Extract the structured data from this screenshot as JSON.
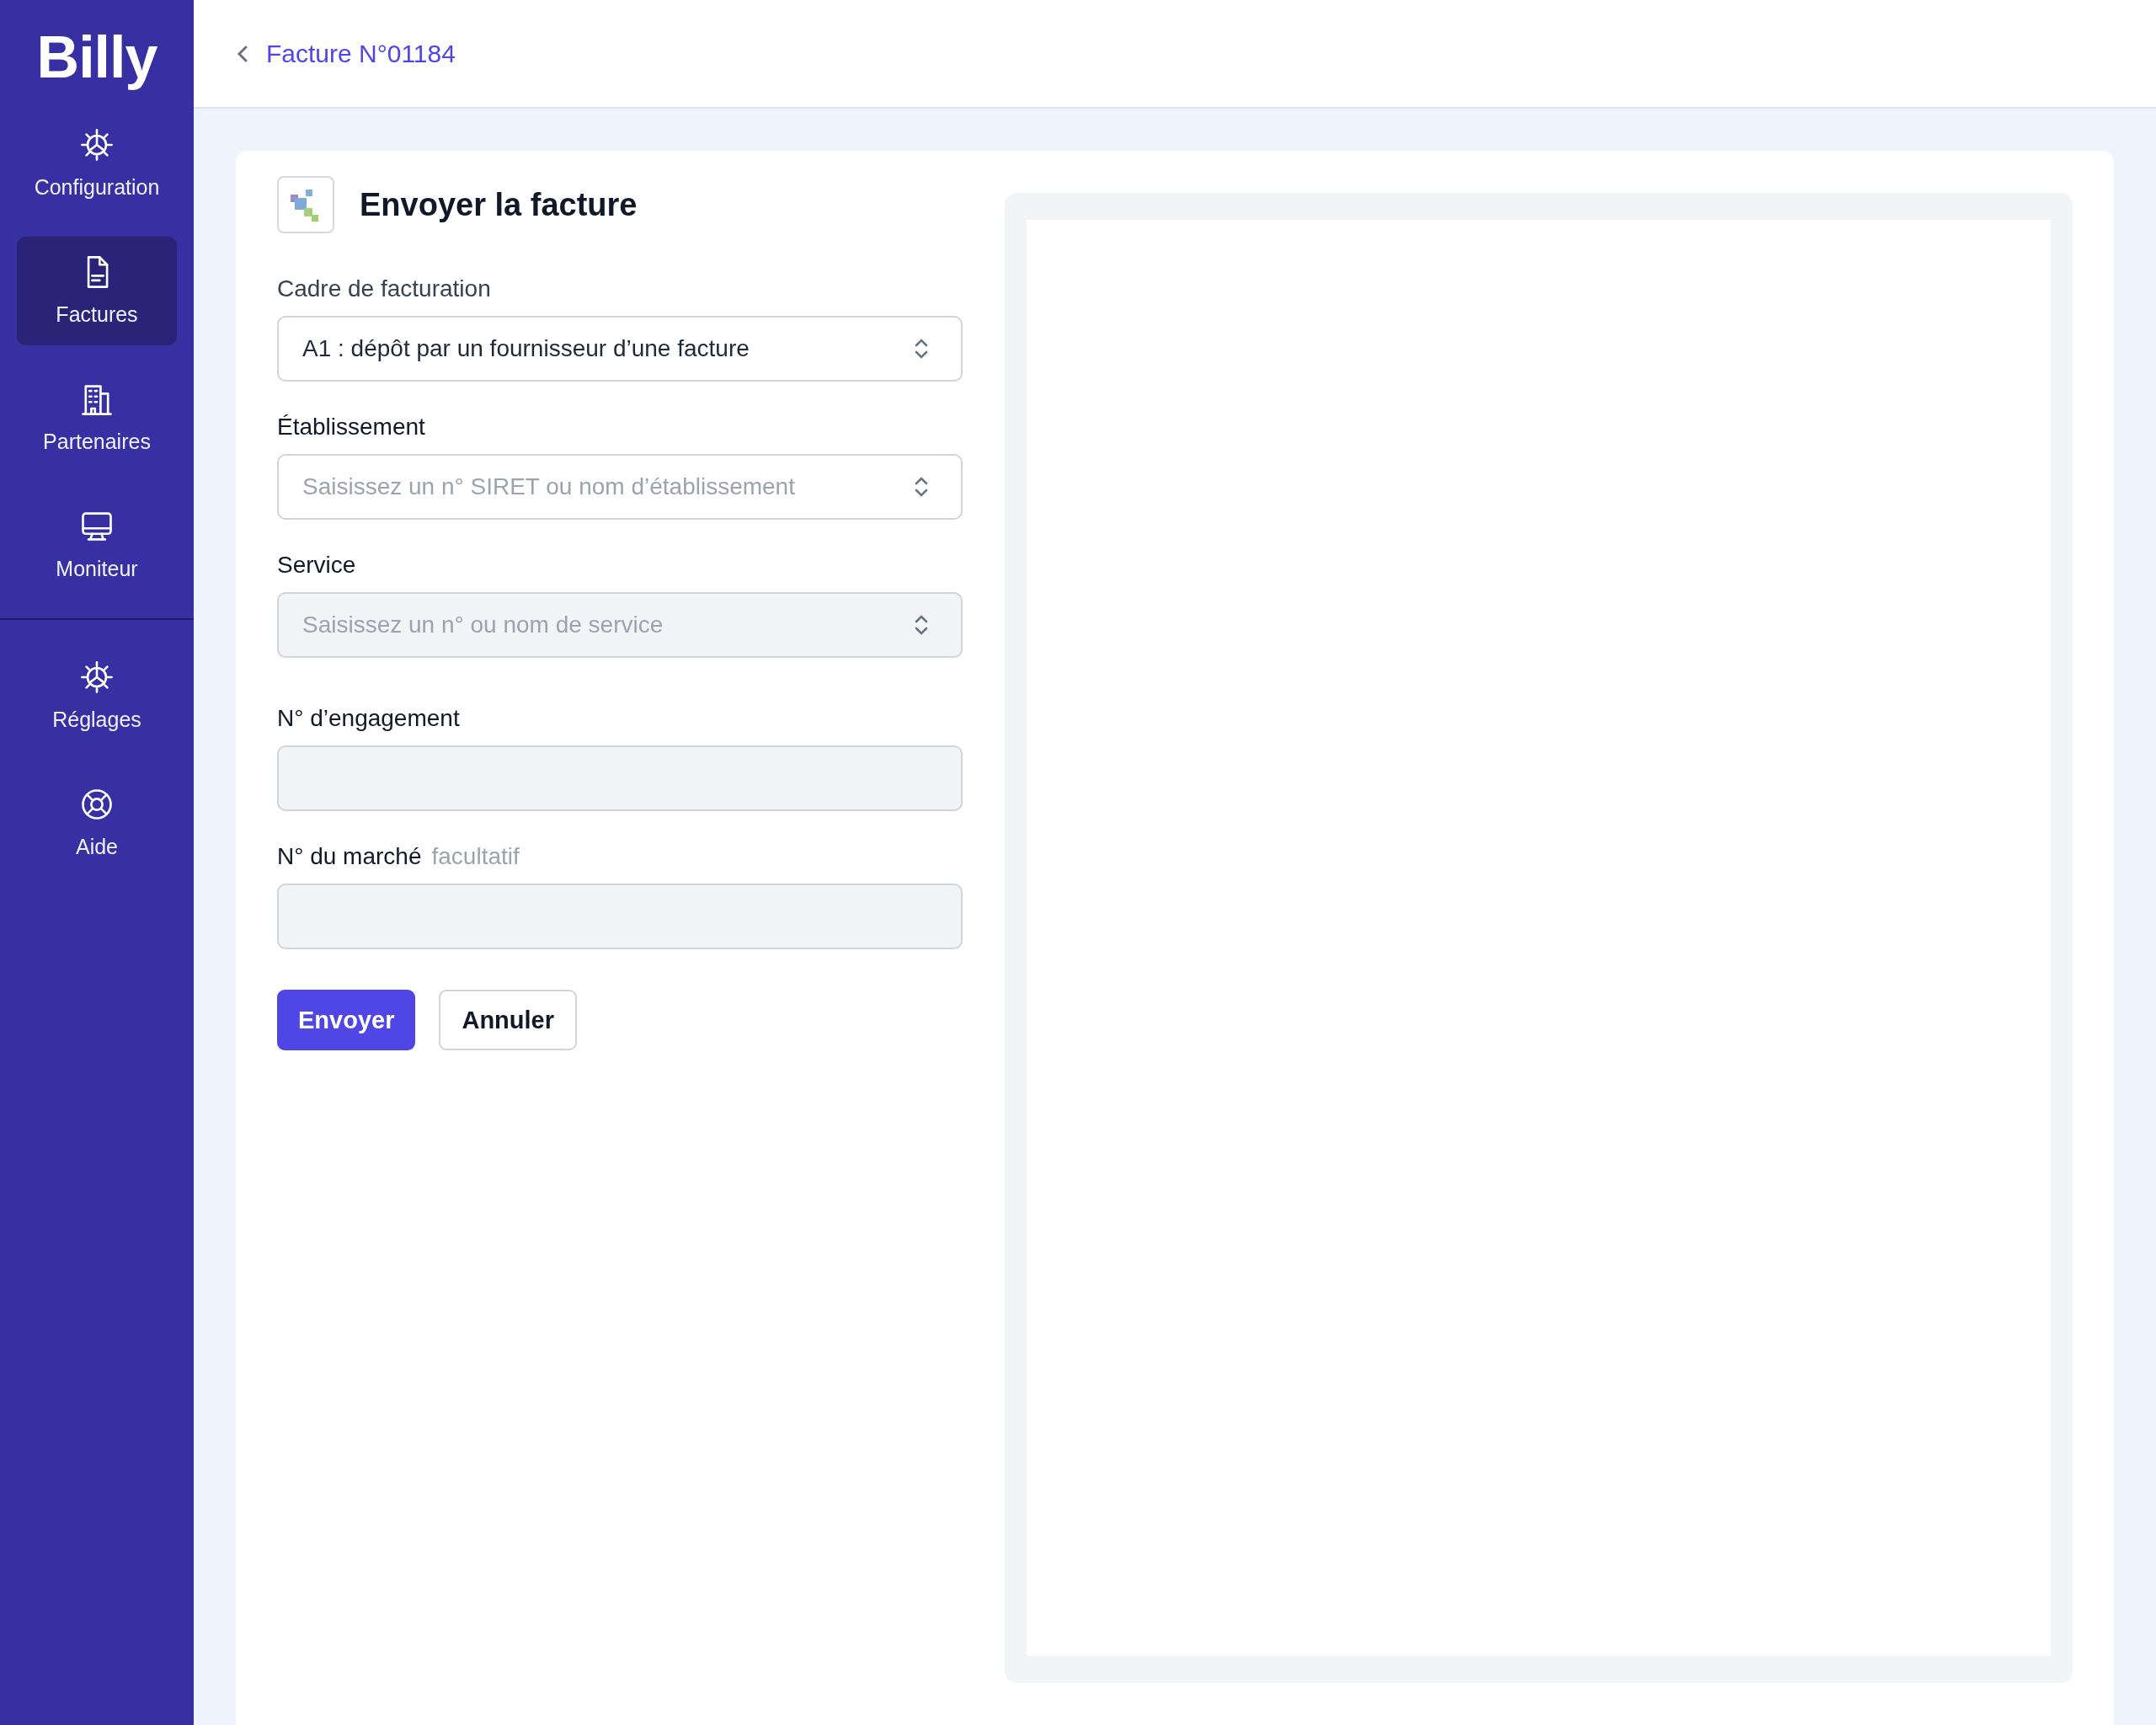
{
  "sidebar": {
    "logo": "Billy",
    "primary": [
      {
        "label": "Configuration",
        "selected": false
      },
      {
        "label": "Factures",
        "selected": true
      },
      {
        "label": "Partenaires",
        "selected": false
      },
      {
        "label": "Moniteur",
        "selected": false
      }
    ],
    "secondary": [
      {
        "label": "Réglages",
        "selected": false
      },
      {
        "label": "Aide",
        "selected": false
      }
    ]
  },
  "header": {
    "breadcrumb": "Facture N°01184"
  },
  "form": {
    "title": "Envoyer la facture",
    "fields": [
      {
        "kind": "select",
        "label": "Cadre de facturation",
        "value": "A1 : dépôt par un fournisseur d’une facture",
        "disabled": false
      },
      {
        "kind": "select",
        "label": "Établissement",
        "placeholder": "Saisissez un n° SIRET ou nom d’établissement",
        "disabled": false
      },
      {
        "kind": "select",
        "label": "Service",
        "placeholder": "Saisissez un n° ou nom de service",
        "disabled": true
      },
      {
        "kind": "input",
        "label": "N° d’engagement",
        "disabled": true
      },
      {
        "kind": "input",
        "label": "N° du marché",
        "hint": "facultatif",
        "disabled": true
      }
    ],
    "buttons": [
      {
        "label": "Envoyer",
        "kind": "primary"
      },
      {
        "label": "Annuler",
        "kind": "secondary"
      }
    ]
  }
}
